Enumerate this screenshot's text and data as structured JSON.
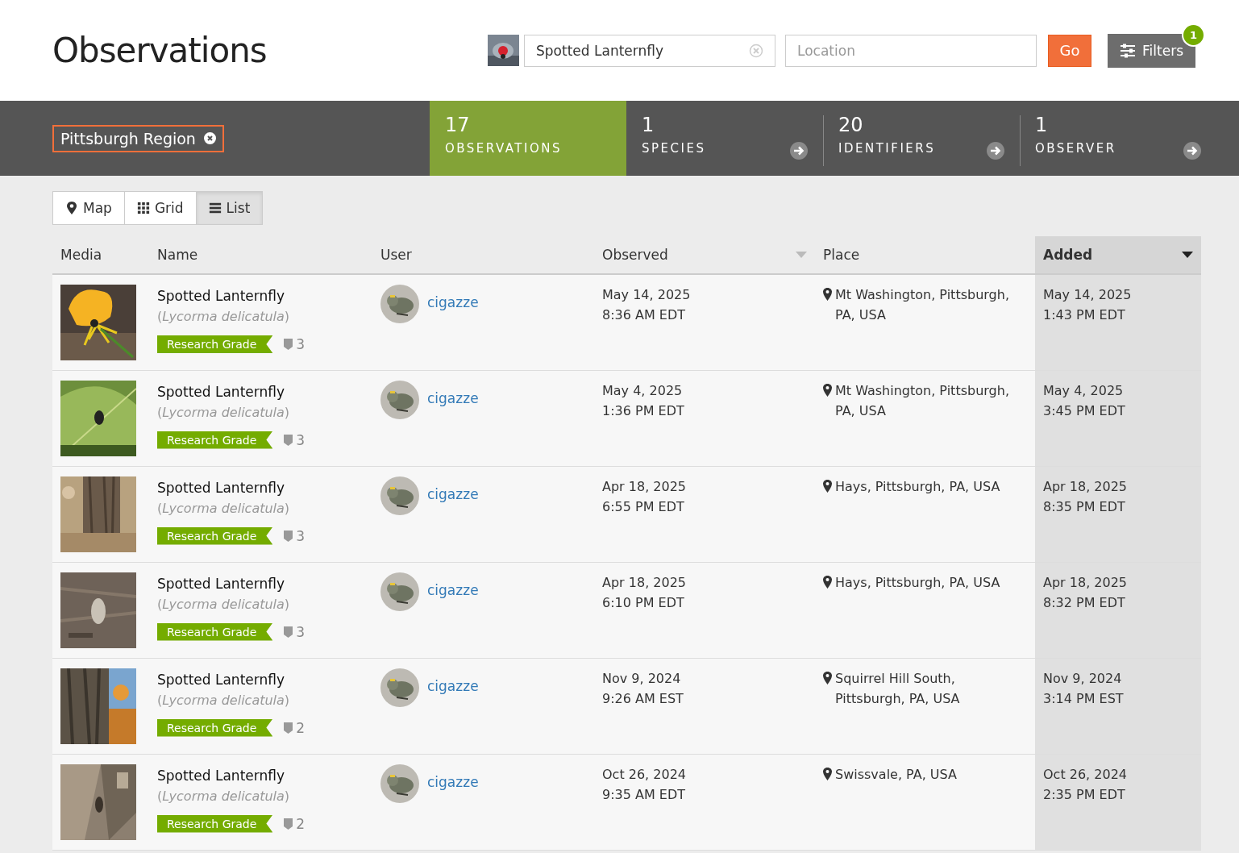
{
  "title": "Observations",
  "search": {
    "taxon": "Spotted Lanternfly",
    "location_placeholder": "Location",
    "go": "Go",
    "filters": "Filters",
    "filter_count": "1"
  },
  "place_chip": "Pittsburgh Region",
  "stats": [
    {
      "number": "17",
      "label": "OBSERVATIONS",
      "selected": true
    },
    {
      "number": "1",
      "label": "SPECIES",
      "selected": false
    },
    {
      "number": "20",
      "label": "IDENTIFIERS",
      "selected": false
    },
    {
      "number": "1",
      "label": "OBSERVER",
      "selected": false
    }
  ],
  "views": [
    {
      "label": "Map",
      "kind": "map",
      "selected": false
    },
    {
      "label": "Grid",
      "kind": "grid",
      "selected": false
    },
    {
      "label": "List",
      "kind": "list",
      "selected": true
    }
  ],
  "table": {
    "columns": [
      {
        "label": "Media",
        "sorted": false,
        "sort_arrow": false
      },
      {
        "label": "Name",
        "sorted": false,
        "sort_arrow": false
      },
      {
        "label": "User",
        "sorted": false,
        "sort_arrow": false
      },
      {
        "label": "Observed",
        "sorted": false,
        "sort_arrow": true
      },
      {
        "label": "Place",
        "sorted": false,
        "sort_arrow": false
      },
      {
        "label": "Added",
        "sorted": true,
        "sort_arrow": true
      }
    ],
    "rows": [
      {
        "name": "Spotted Lanternfly",
        "scientific": "(*Lycorma delicatula*)",
        "grade": "Research Grade",
        "ids": "3",
        "user": "cigazze",
        "observed": [
          "May 14, 2025",
          "8:36 AM EDT"
        ],
        "place": "Mt Washington, Pittsburgh, PA, USA",
        "added": [
          "May 14, 2025",
          "1:43 PM EDT"
        ]
      },
      {
        "name": "Spotted Lanternfly",
        "scientific": "(*Lycorma delicatula*)",
        "grade": "Research Grade",
        "ids": "3",
        "user": "cigazze",
        "observed": [
          "May 4, 2025",
          "1:36 PM EDT"
        ],
        "place": "Mt Washington, Pittsburgh, PA, USA",
        "added": [
          "May 4, 2025",
          "3:45 PM EDT"
        ]
      },
      {
        "name": "Spotted Lanternfly",
        "scientific": "(*Lycorma delicatula*)",
        "grade": "Research Grade",
        "ids": "3",
        "user": "cigazze",
        "observed": [
          "Apr 18, 2025",
          "6:55 PM EDT"
        ],
        "place": "Hays, Pittsburgh, PA, USA",
        "added": [
          "Apr 18, 2025",
          "8:35 PM EDT"
        ]
      },
      {
        "name": "Spotted Lanternfly",
        "scientific": "(*Lycorma delicatula*)",
        "grade": "Research Grade",
        "ids": "3",
        "user": "cigazze",
        "observed": [
          "Apr 18, 2025",
          "6:10 PM EDT"
        ],
        "place": "Hays, Pittsburgh, PA, USA",
        "added": [
          "Apr 18, 2025",
          "8:32 PM EDT"
        ]
      },
      {
        "name": "Spotted Lanternfly",
        "scientific": "(*Lycorma delicatula*)",
        "grade": "Research Grade",
        "ids": "2",
        "user": "cigazze",
        "observed": [
          "Nov 9, 2024",
          "9:26 AM EST"
        ],
        "place": "Squirrel Hill South, Pittsburgh, PA, USA",
        "added": [
          "Nov 9, 2024",
          "3:14 PM EST"
        ]
      },
      {
        "name": "Spotted Lanternfly",
        "scientific": "(*Lycorma delicatula*)",
        "grade": "Research Grade",
        "ids": "2",
        "user": "cigazze",
        "observed": [
          "Oct 26, 2024",
          "9:35 AM EDT"
        ],
        "place": "Swissvale, PA, USA",
        "added": [
          "Oct 26, 2024",
          "2:35 PM EDT"
        ]
      }
    ]
  }
}
